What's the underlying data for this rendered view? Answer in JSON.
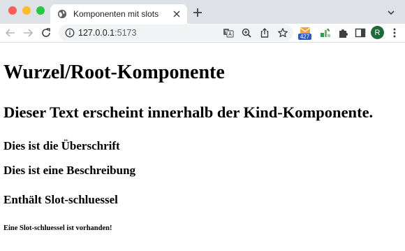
{
  "browser": {
    "tab": {
      "title": "Komponenten mit slots"
    },
    "address": {
      "host": "127.0.0.1",
      "port": ":5173"
    },
    "extensions": {
      "badge_count": "427"
    },
    "profile": {
      "initial": "R"
    }
  },
  "page": {
    "root_heading": "Wurzel/Root-Komponente",
    "child_text": "Dieser Text erscheint innerhalb der Kind-Komponente.",
    "title_slot": "Dies ist die Überschrift",
    "description_slot": "Dies ist eine Beschreibung",
    "contains_slot_key": "Enthält Slot-schluessel",
    "slot_key_present": "Eine Slot-schluessel ist vorhanden!"
  },
  "colors": {
    "tabstrip": "#dee1e6",
    "omnibox": "#f1f3f4",
    "avatar": "#1e6b3a",
    "badge": "#2c58c9"
  }
}
